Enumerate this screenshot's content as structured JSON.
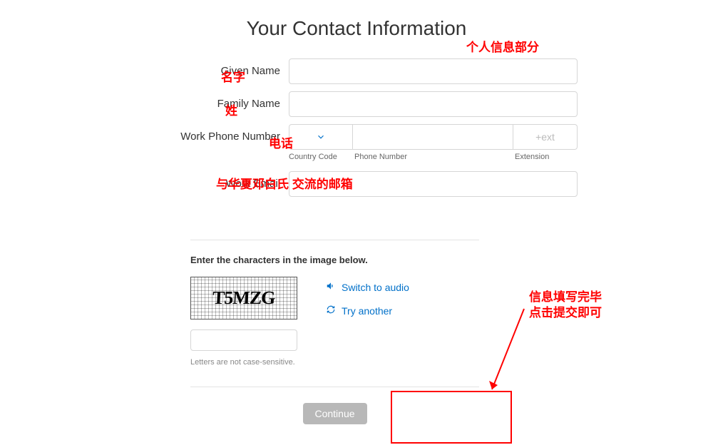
{
  "title": "Your Contact Information",
  "fields": {
    "given_name": {
      "label": "Given Name",
      "value": ""
    },
    "family_name": {
      "label": "Family Name",
      "value": ""
    },
    "work_phone": {
      "label": "Work Phone Number",
      "value": ""
    },
    "work_email": {
      "label": "Work Email",
      "value": ""
    }
  },
  "phone": {
    "ext_placeholder": "+ext",
    "country_code_label": "Country Code",
    "phone_number_label": "Phone Number",
    "extension_label": "Extension"
  },
  "captcha": {
    "header": "Enter the characters in the image below.",
    "image_text": "T5MZG",
    "note": "Letters are not case-sensitive.",
    "switch_audio": "Switch to audio",
    "try_another": "Try another"
  },
  "buttons": {
    "continue": "Continue"
  },
  "annotations": {
    "title": "个人信息部分",
    "given_name": "名字",
    "family_name": "姓",
    "phone": "电话",
    "email": "与华夏邓白氏 交流的邮箱",
    "right1": "信息填写完毕",
    "right2": "点击提交即可"
  }
}
